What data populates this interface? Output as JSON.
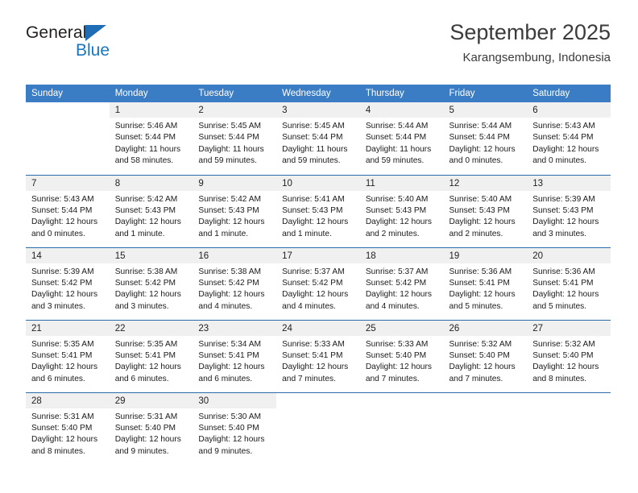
{
  "brand": {
    "name_dark": "General",
    "name_light": "Blue",
    "color_dark": "#231f20",
    "color_blue": "#1b75bc"
  },
  "header": {
    "title": "September 2025",
    "location": "Karangsembung, Indonesia"
  },
  "theme": {
    "header_row_bg": "#3b7dc4",
    "row_divider": "#2b6cab",
    "daynum_bg": "#f0f0f0",
    "text": "#1a1a1a"
  },
  "weekdays": [
    "Sunday",
    "Monday",
    "Tuesday",
    "Wednesday",
    "Thursday",
    "Friday",
    "Saturday"
  ],
  "weeks": [
    [
      {
        "day": "",
        "sunrise": "",
        "sunset": "",
        "daylight1": "",
        "daylight2": ""
      },
      {
        "day": "1",
        "sunrise": "Sunrise: 5:46 AM",
        "sunset": "Sunset: 5:44 PM",
        "daylight1": "Daylight: 11 hours",
        "daylight2": "and 58 minutes."
      },
      {
        "day": "2",
        "sunrise": "Sunrise: 5:45 AM",
        "sunset": "Sunset: 5:44 PM",
        "daylight1": "Daylight: 11 hours",
        "daylight2": "and 59 minutes."
      },
      {
        "day": "3",
        "sunrise": "Sunrise: 5:45 AM",
        "sunset": "Sunset: 5:44 PM",
        "daylight1": "Daylight: 11 hours",
        "daylight2": "and 59 minutes."
      },
      {
        "day": "4",
        "sunrise": "Sunrise: 5:44 AM",
        "sunset": "Sunset: 5:44 PM",
        "daylight1": "Daylight: 11 hours",
        "daylight2": "and 59 minutes."
      },
      {
        "day": "5",
        "sunrise": "Sunrise: 5:44 AM",
        "sunset": "Sunset: 5:44 PM",
        "daylight1": "Daylight: 12 hours",
        "daylight2": "and 0 minutes."
      },
      {
        "day": "6",
        "sunrise": "Sunrise: 5:43 AM",
        "sunset": "Sunset: 5:44 PM",
        "daylight1": "Daylight: 12 hours",
        "daylight2": "and 0 minutes."
      }
    ],
    [
      {
        "day": "7",
        "sunrise": "Sunrise: 5:43 AM",
        "sunset": "Sunset: 5:44 PM",
        "daylight1": "Daylight: 12 hours",
        "daylight2": "and 0 minutes."
      },
      {
        "day": "8",
        "sunrise": "Sunrise: 5:42 AM",
        "sunset": "Sunset: 5:43 PM",
        "daylight1": "Daylight: 12 hours",
        "daylight2": "and 1 minute."
      },
      {
        "day": "9",
        "sunrise": "Sunrise: 5:42 AM",
        "sunset": "Sunset: 5:43 PM",
        "daylight1": "Daylight: 12 hours",
        "daylight2": "and 1 minute."
      },
      {
        "day": "10",
        "sunrise": "Sunrise: 5:41 AM",
        "sunset": "Sunset: 5:43 PM",
        "daylight1": "Daylight: 12 hours",
        "daylight2": "and 1 minute."
      },
      {
        "day": "11",
        "sunrise": "Sunrise: 5:40 AM",
        "sunset": "Sunset: 5:43 PM",
        "daylight1": "Daylight: 12 hours",
        "daylight2": "and 2 minutes."
      },
      {
        "day": "12",
        "sunrise": "Sunrise: 5:40 AM",
        "sunset": "Sunset: 5:43 PM",
        "daylight1": "Daylight: 12 hours",
        "daylight2": "and 2 minutes."
      },
      {
        "day": "13",
        "sunrise": "Sunrise: 5:39 AM",
        "sunset": "Sunset: 5:43 PM",
        "daylight1": "Daylight: 12 hours",
        "daylight2": "and 3 minutes."
      }
    ],
    [
      {
        "day": "14",
        "sunrise": "Sunrise: 5:39 AM",
        "sunset": "Sunset: 5:42 PM",
        "daylight1": "Daylight: 12 hours",
        "daylight2": "and 3 minutes."
      },
      {
        "day": "15",
        "sunrise": "Sunrise: 5:38 AM",
        "sunset": "Sunset: 5:42 PM",
        "daylight1": "Daylight: 12 hours",
        "daylight2": "and 3 minutes."
      },
      {
        "day": "16",
        "sunrise": "Sunrise: 5:38 AM",
        "sunset": "Sunset: 5:42 PM",
        "daylight1": "Daylight: 12 hours",
        "daylight2": "and 4 minutes."
      },
      {
        "day": "17",
        "sunrise": "Sunrise: 5:37 AM",
        "sunset": "Sunset: 5:42 PM",
        "daylight1": "Daylight: 12 hours",
        "daylight2": "and 4 minutes."
      },
      {
        "day": "18",
        "sunrise": "Sunrise: 5:37 AM",
        "sunset": "Sunset: 5:42 PM",
        "daylight1": "Daylight: 12 hours",
        "daylight2": "and 4 minutes."
      },
      {
        "day": "19",
        "sunrise": "Sunrise: 5:36 AM",
        "sunset": "Sunset: 5:41 PM",
        "daylight1": "Daylight: 12 hours",
        "daylight2": "and 5 minutes."
      },
      {
        "day": "20",
        "sunrise": "Sunrise: 5:36 AM",
        "sunset": "Sunset: 5:41 PM",
        "daylight1": "Daylight: 12 hours",
        "daylight2": "and 5 minutes."
      }
    ],
    [
      {
        "day": "21",
        "sunrise": "Sunrise: 5:35 AM",
        "sunset": "Sunset: 5:41 PM",
        "daylight1": "Daylight: 12 hours",
        "daylight2": "and 6 minutes."
      },
      {
        "day": "22",
        "sunrise": "Sunrise: 5:35 AM",
        "sunset": "Sunset: 5:41 PM",
        "daylight1": "Daylight: 12 hours",
        "daylight2": "and 6 minutes."
      },
      {
        "day": "23",
        "sunrise": "Sunrise: 5:34 AM",
        "sunset": "Sunset: 5:41 PM",
        "daylight1": "Daylight: 12 hours",
        "daylight2": "and 6 minutes."
      },
      {
        "day": "24",
        "sunrise": "Sunrise: 5:33 AM",
        "sunset": "Sunset: 5:41 PM",
        "daylight1": "Daylight: 12 hours",
        "daylight2": "and 7 minutes."
      },
      {
        "day": "25",
        "sunrise": "Sunrise: 5:33 AM",
        "sunset": "Sunset: 5:40 PM",
        "daylight1": "Daylight: 12 hours",
        "daylight2": "and 7 minutes."
      },
      {
        "day": "26",
        "sunrise": "Sunrise: 5:32 AM",
        "sunset": "Sunset: 5:40 PM",
        "daylight1": "Daylight: 12 hours",
        "daylight2": "and 7 minutes."
      },
      {
        "day": "27",
        "sunrise": "Sunrise: 5:32 AM",
        "sunset": "Sunset: 5:40 PM",
        "daylight1": "Daylight: 12 hours",
        "daylight2": "and 8 minutes."
      }
    ],
    [
      {
        "day": "28",
        "sunrise": "Sunrise: 5:31 AM",
        "sunset": "Sunset: 5:40 PM",
        "daylight1": "Daylight: 12 hours",
        "daylight2": "and 8 minutes."
      },
      {
        "day": "29",
        "sunrise": "Sunrise: 5:31 AM",
        "sunset": "Sunset: 5:40 PM",
        "daylight1": "Daylight: 12 hours",
        "daylight2": "and 9 minutes."
      },
      {
        "day": "30",
        "sunrise": "Sunrise: 5:30 AM",
        "sunset": "Sunset: 5:40 PM",
        "daylight1": "Daylight: 12 hours",
        "daylight2": "and 9 minutes."
      },
      {
        "day": "",
        "sunrise": "",
        "sunset": "",
        "daylight1": "",
        "daylight2": ""
      },
      {
        "day": "",
        "sunrise": "",
        "sunset": "",
        "daylight1": "",
        "daylight2": ""
      },
      {
        "day": "",
        "sunrise": "",
        "sunset": "",
        "daylight1": "",
        "daylight2": ""
      },
      {
        "day": "",
        "sunrise": "",
        "sunset": "",
        "daylight1": "",
        "daylight2": ""
      }
    ]
  ]
}
